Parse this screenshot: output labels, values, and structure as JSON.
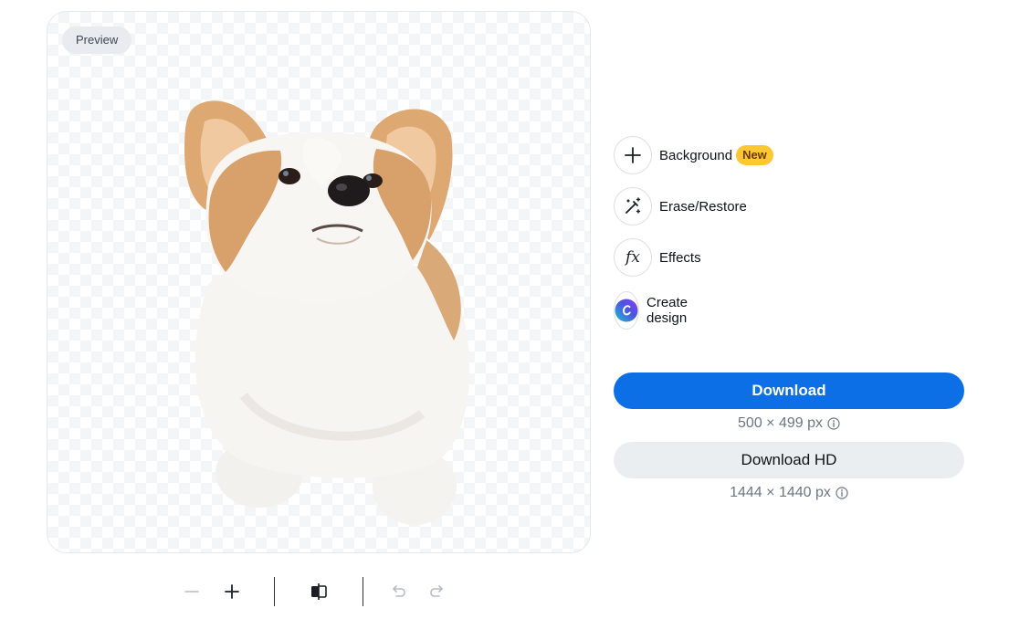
{
  "preview": {
    "badge_label": "Preview",
    "image_alt": "corgi puppy with background removed"
  },
  "tools": [
    {
      "label": "Background",
      "icon": "plus-icon",
      "badge": "New"
    },
    {
      "label": "Erase/Restore",
      "icon": "magic-wand-icon"
    },
    {
      "label": "Effects",
      "icon": "fx-icon",
      "glyph": "fx"
    },
    {
      "label": "Create design",
      "icon": "canva-logo-icon"
    }
  ],
  "download": {
    "label": "Download",
    "size": "500 × 499 px",
    "color": "#0d6fe5"
  },
  "download_hd": {
    "label": "Download HD",
    "size": "1444 × 1440 px"
  },
  "bottom_toolbar": {
    "zoom_out": "minus-icon",
    "zoom_in": "plus-icon",
    "compare": "compare-split-icon",
    "undo": "undo-icon",
    "redo": "redo-icon"
  },
  "colors": {
    "new_badge": "#ffc833",
    "secondary_button": "#ebeef1"
  }
}
